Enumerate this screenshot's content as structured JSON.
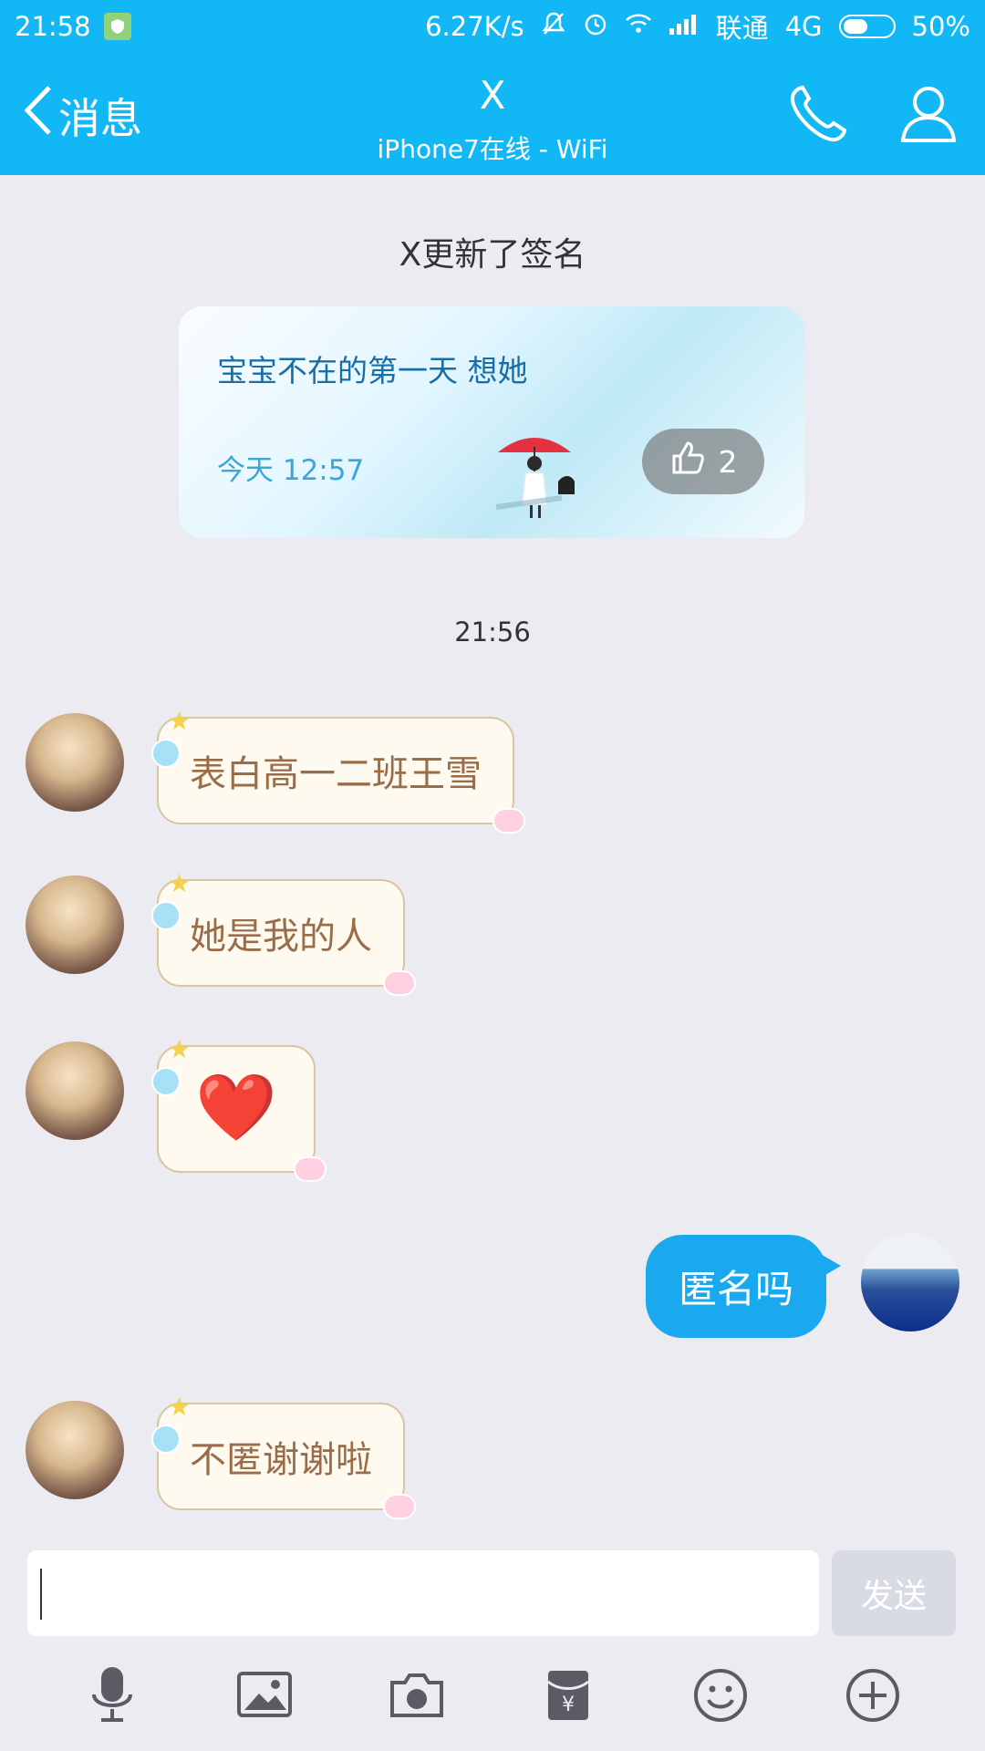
{
  "status_bar": {
    "time": "21:58",
    "speed": "6.27K/s",
    "carrier": "联通",
    "network": "4G",
    "battery": "50%",
    "battery_level": 0.5
  },
  "header": {
    "back_label": "消息",
    "title": "X",
    "subtitle": "iPhone7在线 - WiFi"
  },
  "system_notice": "X更新了签名",
  "signature": {
    "text": "宝宝不在的第一天 想她",
    "time": "今天 12:57",
    "like_count": "2"
  },
  "timestamp": "21:56",
  "messages": [
    {
      "side": "left",
      "text": "表白高一二班王雪"
    },
    {
      "side": "left",
      "text": "她是我的人"
    },
    {
      "side": "left",
      "text": "❤️",
      "is_emoji": true
    },
    {
      "side": "right",
      "text": "匿名吗"
    },
    {
      "side": "left",
      "text": "不匿谢谢啦"
    }
  ],
  "composer": {
    "input_value": "",
    "send_label": "发送"
  },
  "toolbar_icons": [
    "microphone-icon",
    "image-icon",
    "camera-icon",
    "red-packet-icon",
    "emoji-icon",
    "plus-icon"
  ]
}
